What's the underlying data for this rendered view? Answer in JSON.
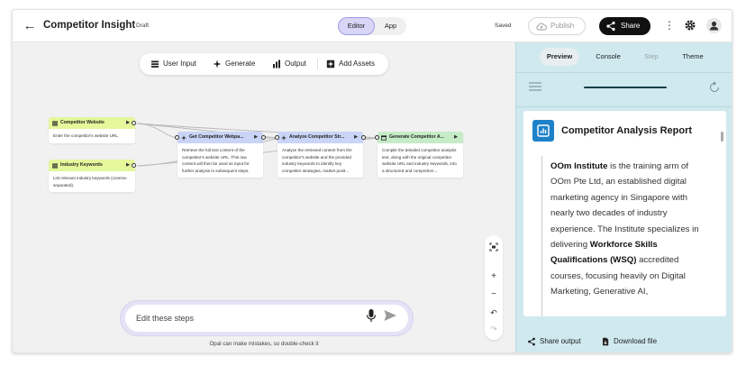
{
  "header": {
    "title": "Competitor Insight",
    "draft": "Draft",
    "modes": [
      "Editor",
      "App"
    ],
    "saved": "Saved",
    "publish": "Publish",
    "share": "Share"
  },
  "toolbar": {
    "user_input": "User Input",
    "generate": "Generate",
    "output": "Output",
    "add_assets": "Add Assets"
  },
  "nodes": {
    "website": {
      "title": "Competitor Website",
      "body": "Enter the competitor's website URL."
    },
    "keywords": {
      "title": "Industry Keywords",
      "body": "List relevant industry keywords (comma-separated)."
    },
    "get": {
      "title": "Get Competitor Webpa...",
      "body": "Retrieve the full text content of the competitor's website URL. This raw content will then be used as input for further analysis in subsequent steps."
    },
    "analyze": {
      "title": "Analyze Competitor Str...",
      "body": "Analyze the retrieved content from the competitor's website and the provided industry keywords to identify key competitor strategies, market posit..."
    },
    "generate": {
      "title": "Generate Competitor A...",
      "body": "Compile the detailed competitor analysis text, along with the original competitor website URL and industry keywords, into a structured and comprehen..."
    }
  },
  "chat": {
    "placeholder": "Edit these steps",
    "disclaimer": "Opal can make mistakes, so double-check it"
  },
  "right": {
    "tabs": [
      "Preview",
      "Console",
      "Step",
      "Theme"
    ],
    "report_title": "Competitor Analysis Report",
    "para": {
      "b1": "OOm Institute",
      "t1": " is the training arm of OOm Pte Ltd, an established digital marketing agency in Singapore with nearly two decades of industry experience. The Institute specializes in delivering ",
      "b2": "Workforce Skills Qualifications (WSQ)",
      "t2": " accredited courses, focusing heavily on Digital Marketing, Generative AI,"
    },
    "share_output": "Share output",
    "download_file": "Download file"
  }
}
